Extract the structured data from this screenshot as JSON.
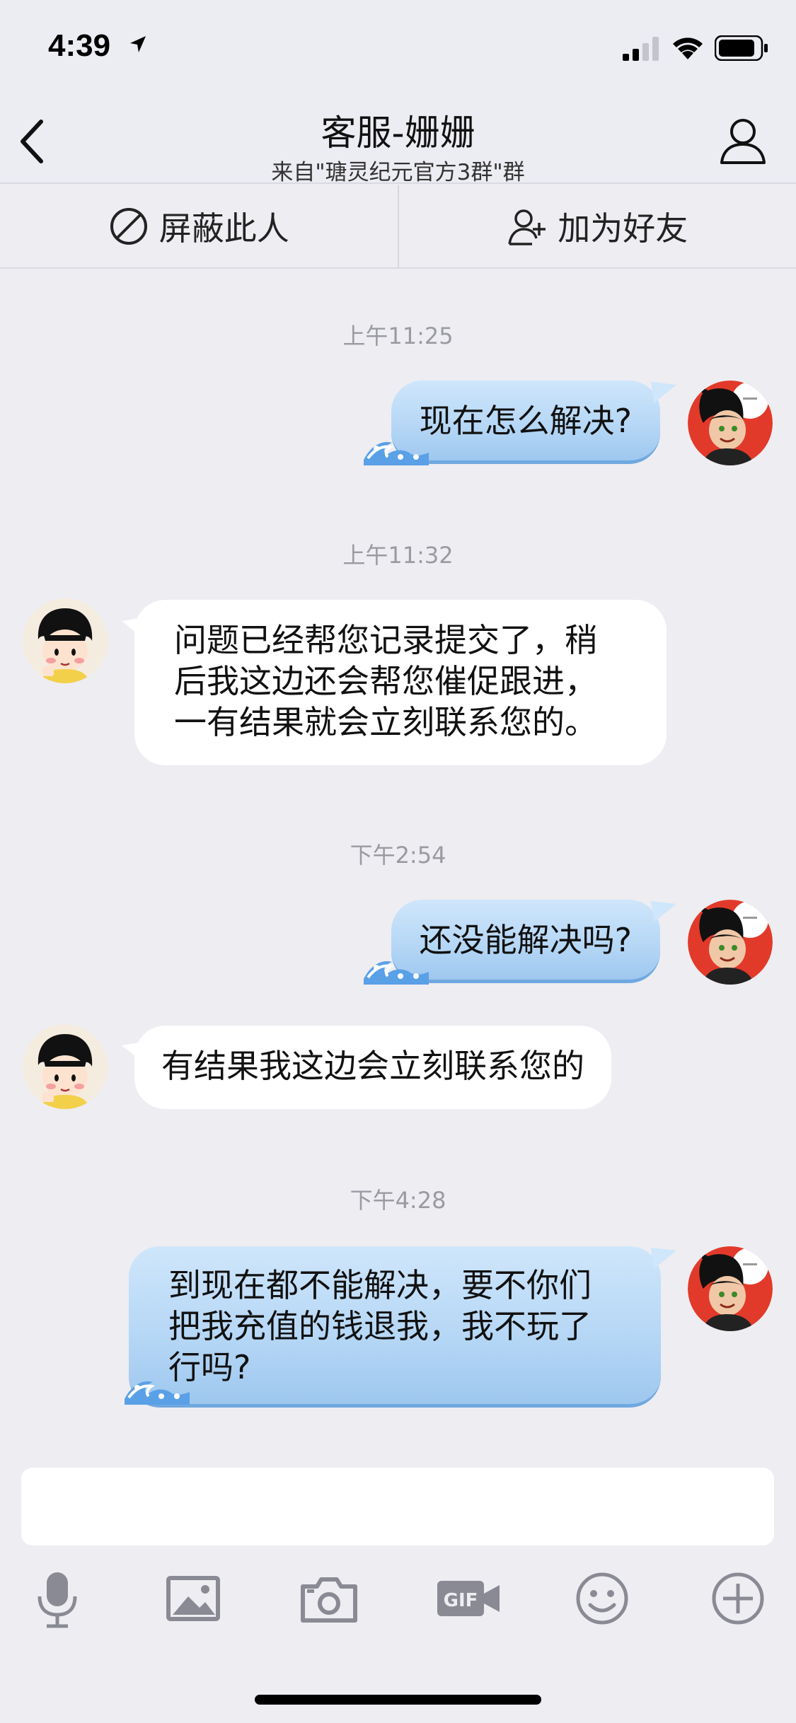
{
  "status_bar": {
    "time": "4:39"
  },
  "nav": {
    "title": "客服-姗姗",
    "subtitle": "来自\"瑭灵纪元官方3群\"群"
  },
  "actions": {
    "block_label": "屏蔽此人",
    "add_friend_label": "加为好友"
  },
  "messages": [
    {
      "timestamp": "上午11:25",
      "side": "out",
      "lines": [
        "现在怎么解决?"
      ]
    },
    {
      "timestamp": "上午11:32",
      "side": "in",
      "lines": [
        "问题已经帮您记录提交了，稍",
        "后我这边还会帮您催促跟进，",
        "一有结果就会立刻联系您的。"
      ]
    },
    {
      "timestamp": "下午2:54",
      "side": "out",
      "lines": [
        "还没能解决吗?"
      ]
    },
    {
      "timestamp": "",
      "side": "in",
      "lines": [
        "有结果我这边会立刻联系您的"
      ]
    },
    {
      "timestamp": "下午4:28",
      "side": "out",
      "lines": [
        "到现在都不能解决，要不你们",
        "把我充值的钱退我，我不玩了",
        "行吗?"
      ]
    }
  ],
  "toolbar": {
    "icons": [
      "microphone-icon",
      "image-icon",
      "camera-icon",
      "gif-icon",
      "emoji-icon",
      "plus-icon"
    ]
  },
  "colors": {
    "background": "#ededf2",
    "outgoing_bubble": "#b4d6f5",
    "incoming_bubble": "#ffffff",
    "timestamp": "#9a9aa2",
    "icon": "#8a8a94"
  }
}
